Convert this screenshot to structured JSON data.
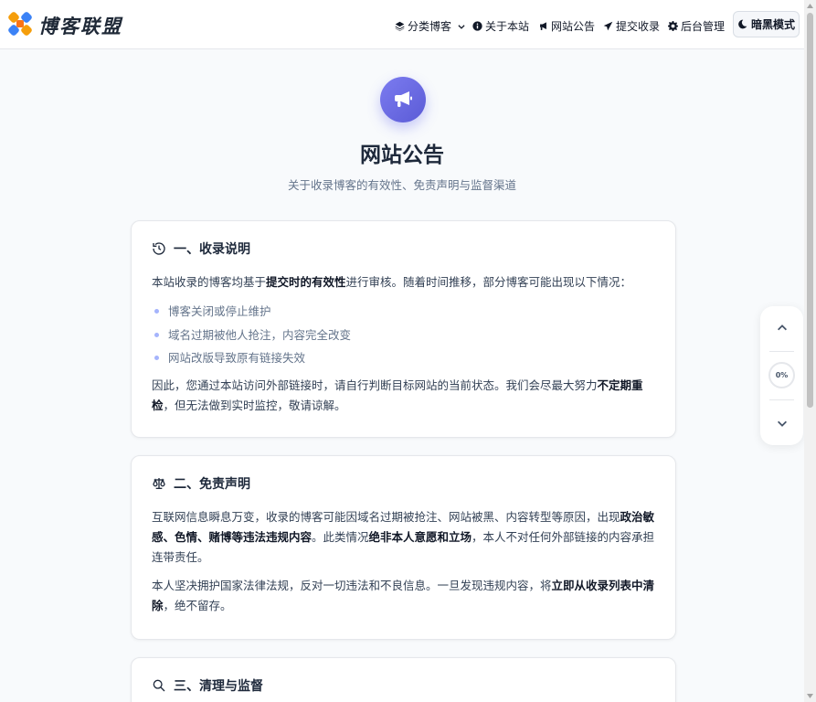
{
  "header": {
    "brand": "博客联盟",
    "nav": [
      {
        "label": "分类博客",
        "icon": "layers-icon"
      },
      {
        "label": "关于本站",
        "icon": "info-icon"
      },
      {
        "label": "网站公告",
        "icon": "bullhorn-icon"
      },
      {
        "label": "提交收录",
        "icon": "paper-plane-icon"
      },
      {
        "label": "后台管理",
        "icon": "gear-icon"
      }
    ],
    "dark_mode_label": "暗黑模式"
  },
  "hero": {
    "title": "网站公告",
    "subtitle": "关于收录博客的有效性、免责声明与监督渠道"
  },
  "sections": {
    "s1": {
      "title": "一、收录说明",
      "p1_a": "本站收录的博客均基于",
      "p1_b": "提交时的有效性",
      "p1_c": "进行审核。随着时间推移，部分博客可能出现以下情况：",
      "list": [
        "博客关闭或停止维护",
        "域名过期被他人抢注，内容完全改变",
        "网站改版导致原有链接失效"
      ],
      "p2_a": "因此，您通过本站访问外部链接时，请自行判断目标网站的当前状态。我们会尽最大努力",
      "p2_b": "不定期重检",
      "p2_c": "，但无法做到实时监控，敬请谅解。"
    },
    "s2": {
      "title": "二、免责声明",
      "p1_a": "互联网信息瞬息万变，收录的博客可能因域名过期被抢注、网站被黑、内容转型等原因，出现",
      "p1_b": "政治敏感、色情、赌博等违法违规内容",
      "p1_c": "。此类情况",
      "p1_d": "绝非本人意愿和立场",
      "p1_e": "，本人不对任何外部链接的内容承担连带责任。",
      "p2_a": "本人坚决拥护国家法律法规，反对一切违法和不良信息。一旦发现违规内容，将",
      "p2_b": "立即从收录列表中清除",
      "p2_c": "，绝不留存。"
    },
    "s3": {
      "title": "三、清理与监督"
    }
  },
  "scroll_widget": {
    "progress_label": "0%"
  },
  "colors": {
    "accent": "#6366f1",
    "background": "#f8fafc",
    "text": "#1e293b"
  }
}
